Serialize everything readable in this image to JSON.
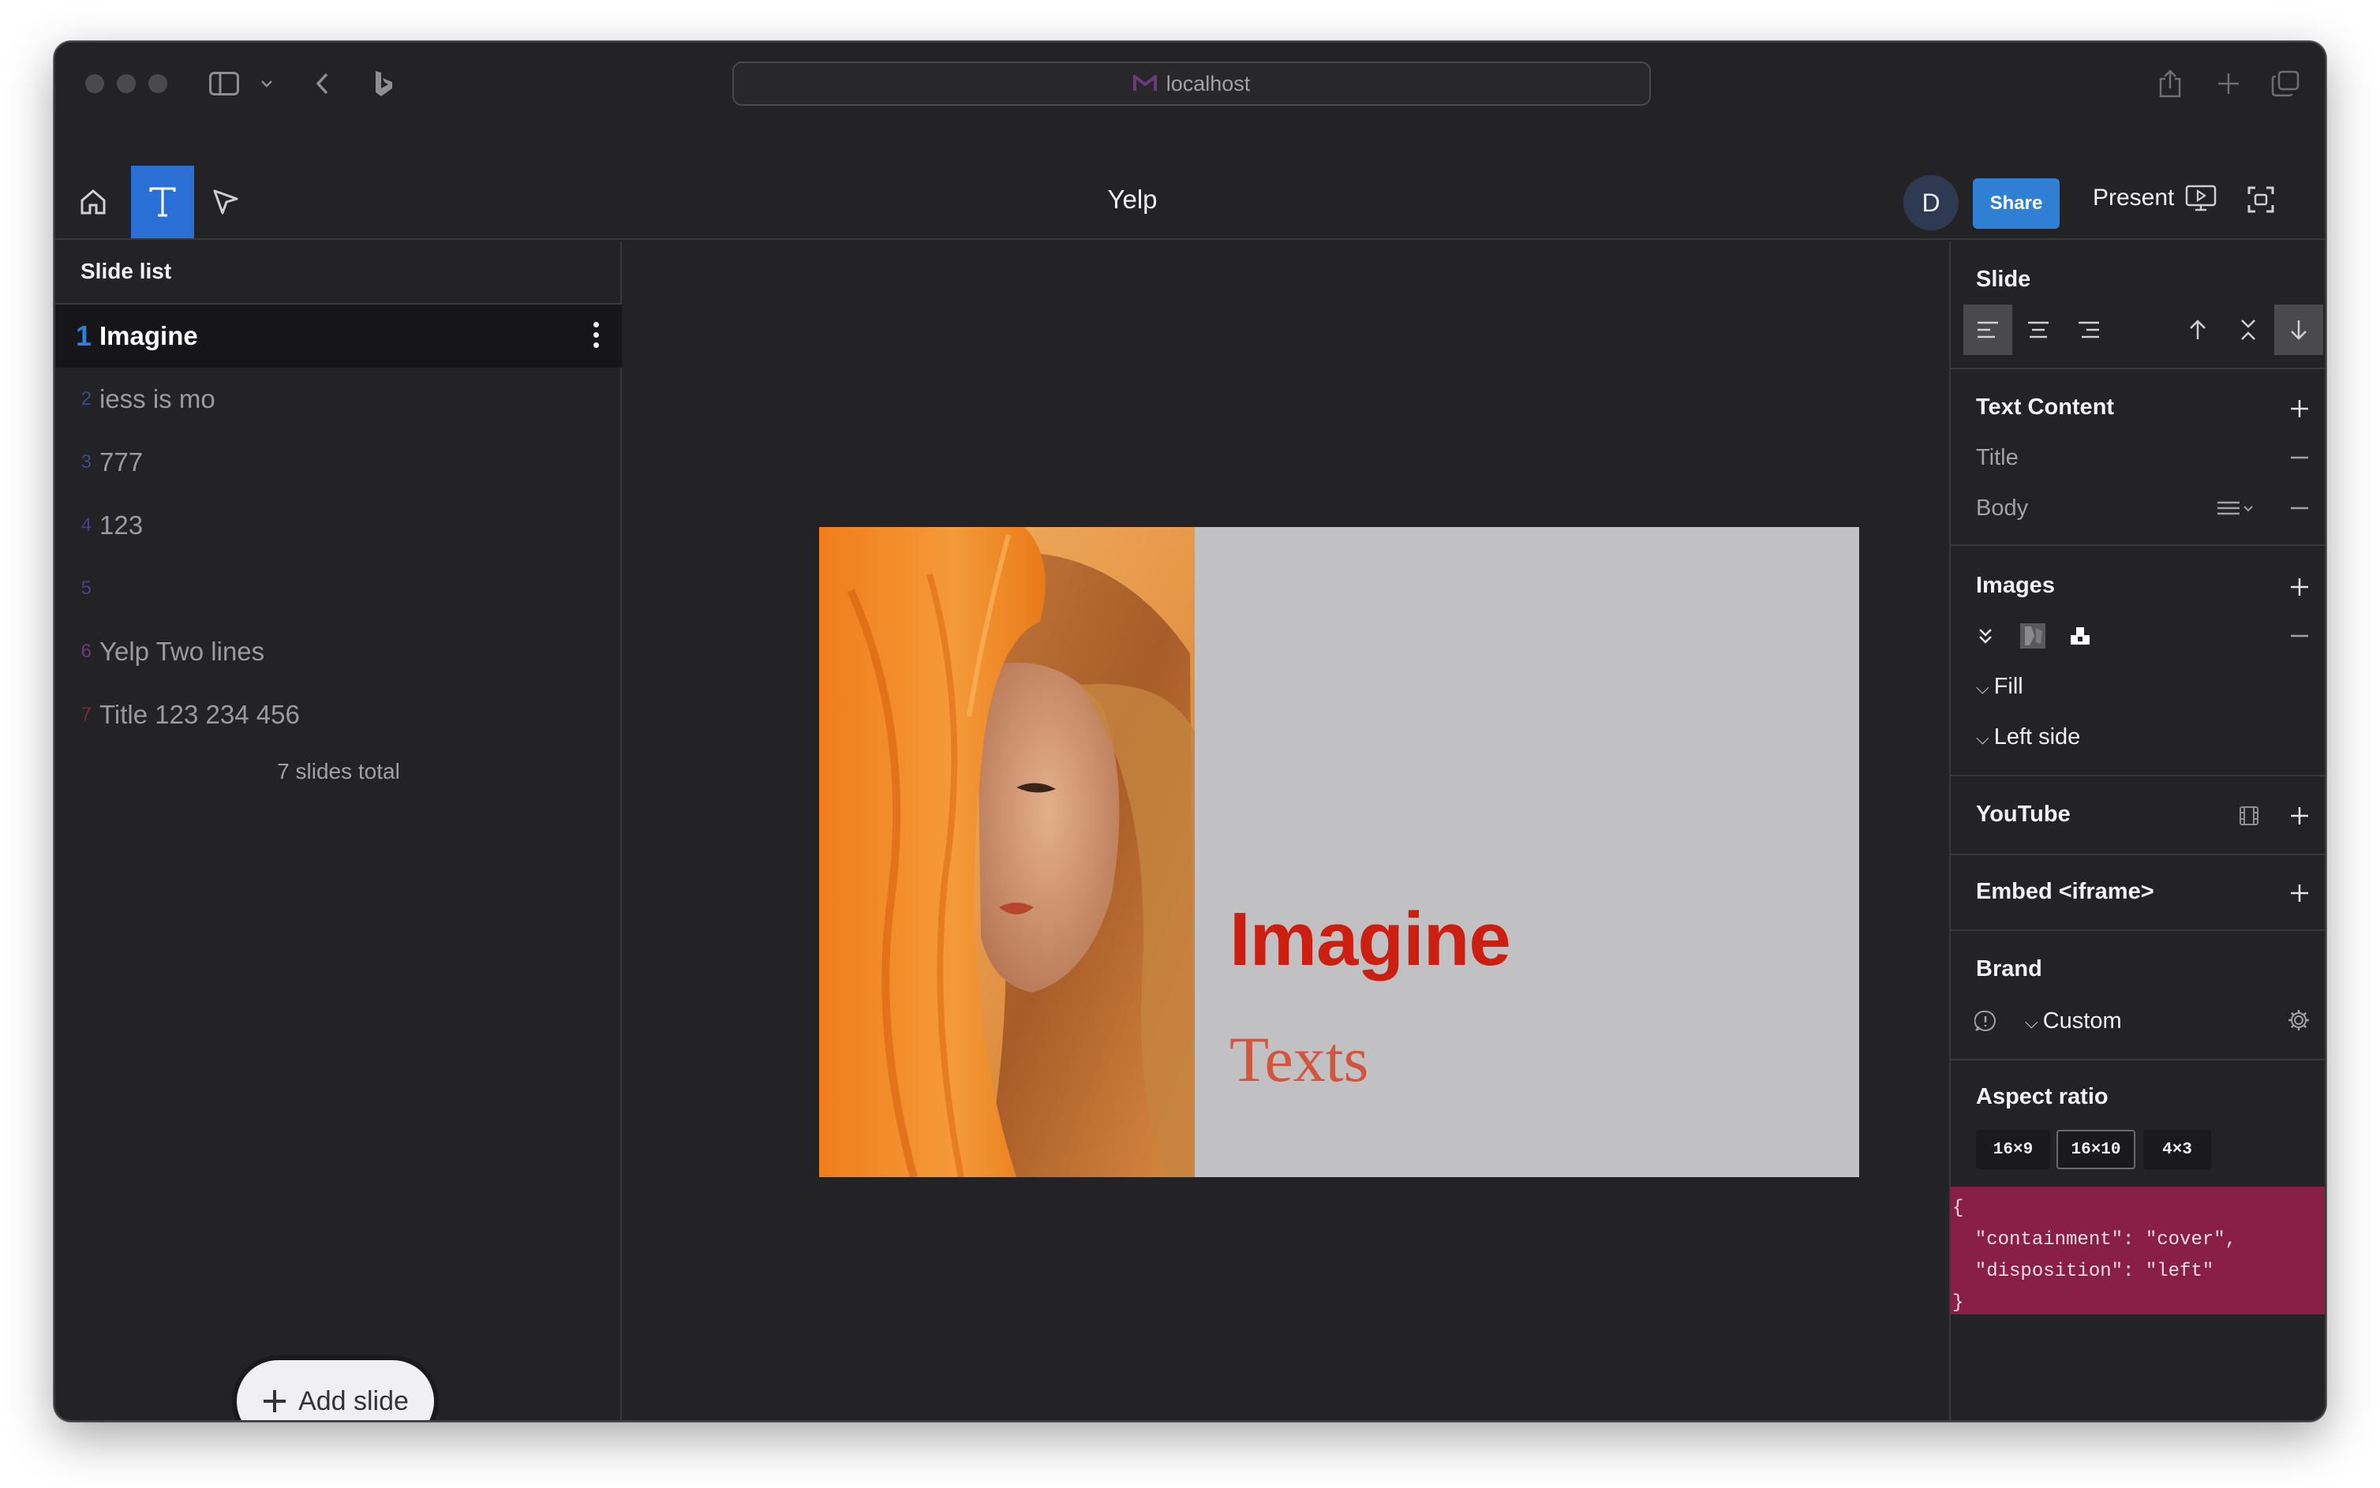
{
  "browser": {
    "url": "localhost"
  },
  "toolbar": {
    "doc_title": "Yelp",
    "avatar_letter": "D",
    "share_label": "Share",
    "present_label": "Present"
  },
  "slide_list": {
    "title": "Slide list",
    "items": [
      {
        "num": "1",
        "label": "Imagine",
        "num_color": "#2f7fd4"
      },
      {
        "num": "2",
        "label": "iess is mo",
        "num_color": "#3a4a8a"
      },
      {
        "num": "3",
        "label": "777",
        "num_color": "#3a4a8a"
      },
      {
        "num": "4",
        "label": "123",
        "num_color": "#4a3f8a"
      },
      {
        "num": "5",
        "label": "",
        "num_color": "#4a3f8a"
      },
      {
        "num": "6",
        "label": "Yelp Two lines",
        "num_color": "#6a3a7a"
      },
      {
        "num": "7",
        "label": "Title 123 234 456",
        "num_color": "#7a2a3a"
      }
    ],
    "total_label": "7 slides total",
    "add_label": "Add slide"
  },
  "slide": {
    "title": "Imagine",
    "body": "Texts",
    "title_color": "#cc1f12",
    "body_color": "#d4553e",
    "background": "#c1c1c3"
  },
  "inspector": {
    "slide_title": "Slide",
    "text_content_title": "Text Content",
    "title_row": "Title",
    "body_row": "Body",
    "images_title": "Images",
    "fill_label": "Fill",
    "left_side_label": "Left side",
    "youtube_title": "YouTube",
    "embed_title": "Embed <iframe>",
    "brand_title": "Brand",
    "brand_value": "Custom",
    "aspect_title": "Aspect ratio",
    "aspect_options": [
      "16×9",
      "16×10",
      "4×3"
    ],
    "aspect_selected": "16×10",
    "json_preview": "{\n  \"containment\": \"cover\",\n  \"disposition\": \"left\"\n}"
  }
}
